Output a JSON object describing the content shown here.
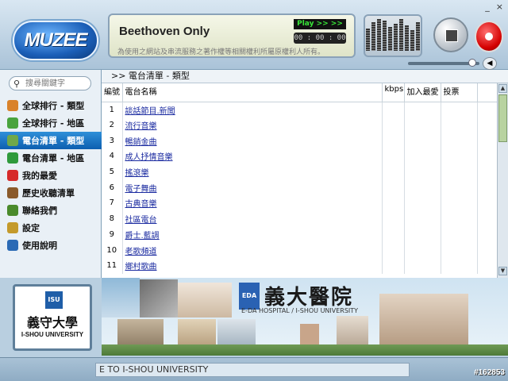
{
  "window": {
    "minimize_label": "_",
    "close_label": "×"
  },
  "app": {
    "logo_text": "MUZEE"
  },
  "player": {
    "now_playing": "Beethoven Only",
    "play_status": "Play >> >>",
    "time": "00 : 00 : 00",
    "disclaimer": "為使用之網站及串流服務之著作權等相關權利所屬原權利人所有。"
  },
  "search": {
    "placeholder": "搜尋關鍵字"
  },
  "nav": {
    "items": [
      {
        "label": "全球排行 - 類型",
        "icon": "globe-icon",
        "color": "#d9822b"
      },
      {
        "label": "全球排行 - 地區",
        "icon": "globe-icon",
        "color": "#49a33d"
      },
      {
        "label": "電台清單 - 類型",
        "icon": "music-note-icon",
        "color": "#6fa84a"
      },
      {
        "label": "電台清單 - 地區",
        "icon": "globe-icon",
        "color": "#2f9a3c"
      },
      {
        "label": "我的最愛",
        "icon": "heart-icon",
        "color": "#d62b2b"
      },
      {
        "label": "歷史收聽清單",
        "icon": "history-icon",
        "color": "#8a5a2b"
      },
      {
        "label": "聯絡我們",
        "icon": "contact-icon",
        "color": "#4a8a2b"
      },
      {
        "label": "設定",
        "icon": "settings-icon",
        "color": "#c49a2b"
      },
      {
        "label": "使用說明",
        "icon": "help-book-icon",
        "color": "#2b6ab5"
      }
    ],
    "active_index": 2
  },
  "breadcrumb": ">> 電台清單 - 類型",
  "table": {
    "headers": {
      "num": "編號",
      "name": "電台名稱",
      "kbps": "kbps",
      "fav": "加入最愛",
      "vote": "投票"
    },
    "rows": [
      {
        "num": "1",
        "name": "談話節目.新聞"
      },
      {
        "num": "2",
        "name": "流行音樂"
      },
      {
        "num": "3",
        "name": "暢銷金曲"
      },
      {
        "num": "4",
        "name": "成人抒情音樂"
      },
      {
        "num": "5",
        "name": "搖滾樂"
      },
      {
        "num": "6",
        "name": "電子舞曲"
      },
      {
        "num": "7",
        "name": "古典音樂"
      },
      {
        "num": "8",
        "name": "社區電台"
      },
      {
        "num": "9",
        "name": "爵士.藍調"
      },
      {
        "num": "10",
        "name": "老歌頻道"
      },
      {
        "num": "11",
        "name": "鄉村歌曲"
      }
    ]
  },
  "school": {
    "name_cn": "義守大學",
    "name_en": "I-SHOU UNIVERSITY",
    "emblem": "ISU"
  },
  "banner": {
    "hospital_cn": "義大醫院",
    "hospital_en": "E-DA HOSPITAL / I-SHOU UNIVERSITY",
    "hospital_logo": "EDA"
  },
  "ticker": "E TO I-SHOU UNIVERSITY",
  "watermark": "#162853"
}
